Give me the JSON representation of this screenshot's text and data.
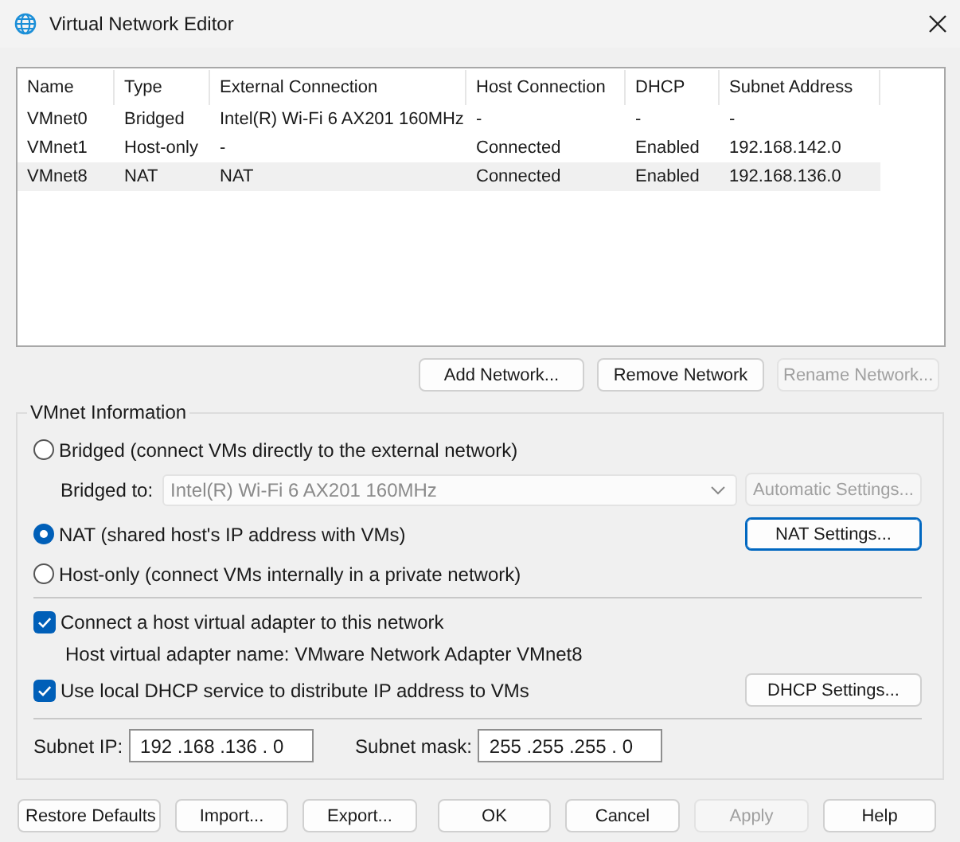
{
  "window": {
    "title": "Virtual Network Editor"
  },
  "table": {
    "columns": [
      "Name",
      "Type",
      "External Connection",
      "Host Connection",
      "DHCP",
      "Subnet Address"
    ],
    "rows": [
      {
        "cells": [
          "VMnet0",
          "Bridged",
          "Intel(R) Wi-Fi 6 AX201 160MHz",
          "-",
          "-",
          "-"
        ],
        "selected": false
      },
      {
        "cells": [
          "VMnet1",
          "Host-only",
          "-",
          "Connected",
          "Enabled",
          "192.168.142.0"
        ],
        "selected": false
      },
      {
        "cells": [
          "VMnet8",
          "NAT",
          "NAT",
          "Connected",
          "Enabled",
          "192.168.136.0"
        ],
        "selected": true
      }
    ]
  },
  "network_buttons": [
    {
      "label": "Add Network...",
      "disabled": false
    },
    {
      "label": "Remove Network",
      "disabled": false
    },
    {
      "label": "Rename Network...",
      "disabled": true
    }
  ],
  "vmnet_information": {
    "title": "VMnet Information",
    "connection_types": [
      {
        "label": "Bridged (connect VMs directly to the external network)",
        "selected": false
      },
      {
        "label": "NAT (shared host's IP address with VMs)",
        "selected": true
      },
      {
        "label": "Host-only (connect VMs internally in a private network)",
        "selected": false
      }
    ],
    "bridged_to": {
      "label": "Bridged to:",
      "value": "Intel(R) Wi-Fi 6 AX201 160MHz",
      "disabled": true
    },
    "automatic_settings_button": {
      "label": "Automatic Settings...",
      "disabled": true
    },
    "nat_settings_button": {
      "label": "NAT Settings...",
      "disabled": false,
      "focused": true
    },
    "connect_adapter": {
      "label": "Connect a host virtual adapter to this network",
      "checked": true
    },
    "adapter_name": "Host virtual adapter name: VMware Network Adapter VMnet8",
    "dhcp": {
      "label": "Use local DHCP service to distribute IP address to VMs",
      "checked": true
    },
    "dhcp_settings_button": {
      "label": "DHCP Settings...",
      "disabled": false
    },
    "subnet_ip": {
      "label": "Subnet IP:",
      "value": "192 .168 .136 . 0"
    },
    "subnet_mask": {
      "label": "Subnet mask:",
      "value": "255 .255 .255 . 0"
    }
  },
  "footer_buttons": [
    {
      "label": "Restore Defaults",
      "disabled": false
    },
    {
      "label": "Import...",
      "disabled": false
    },
    {
      "label": "Export...",
      "disabled": false
    },
    {
      "label": "OK",
      "disabled": false
    },
    {
      "label": "Cancel",
      "disabled": false
    },
    {
      "label": "Apply",
      "disabled": true
    },
    {
      "label": "Help",
      "disabled": false
    }
  ]
}
